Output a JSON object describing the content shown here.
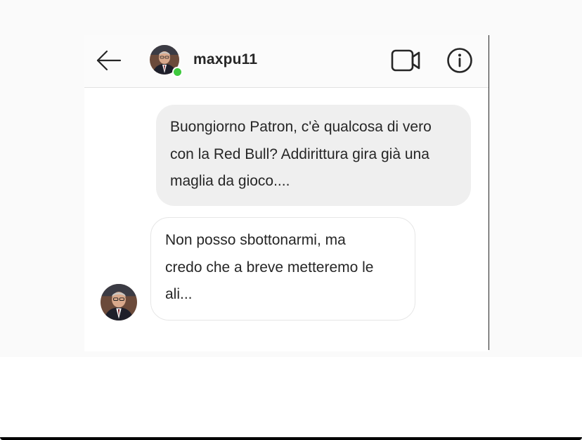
{
  "header": {
    "username": "maxpu11",
    "online": true
  },
  "icons": {
    "back": "arrow-left-icon",
    "video": "video-camera-icon",
    "info": "info-icon"
  },
  "messages": [
    {
      "direction": "sent",
      "text": "Buongiorno Patron, c'è qualcosa di vero\ncon la Red Bull? Addirittura gira già una\nmaglia da gioco...."
    },
    {
      "direction": "received",
      "text": "Non posso sbottonarmi, ma\ncredo che a breve metteremo le\nali..."
    }
  ],
  "colors": {
    "online_dot": "#3ec93e",
    "sent_bubble": "#efefef",
    "text": "#262626"
  }
}
